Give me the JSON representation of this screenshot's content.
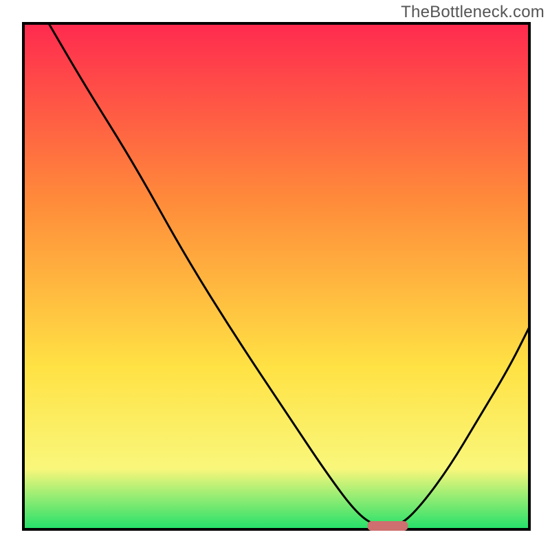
{
  "watermark": "TheBottleneck.com",
  "chart_data": {
    "type": "line",
    "title": "",
    "xlabel": "",
    "ylabel": "",
    "xlim": [
      0,
      100
    ],
    "ylim": [
      0,
      100
    ],
    "note": "No axis ticks or numeric labels are rendered in the image. The black curve descends from top-left, reaches a flat minimum around x≈68–74, then rises toward the right. A short salmon-colored marker band sits on the x-axis at the minimum.",
    "series": [
      {
        "name": "bottleneck_curve",
        "color": "#000000",
        "points": [
          {
            "x": 5,
            "y": 100
          },
          {
            "x": 12,
            "y": 88
          },
          {
            "x": 22,
            "y": 72
          },
          {
            "x": 32,
            "y": 54
          },
          {
            "x": 42,
            "y": 38
          },
          {
            "x": 52,
            "y": 23
          },
          {
            "x": 60,
            "y": 11
          },
          {
            "x": 66,
            "y": 3
          },
          {
            "x": 70,
            "y": 0.5
          },
          {
            "x": 74,
            "y": 0.5
          },
          {
            "x": 78,
            "y": 4
          },
          {
            "x": 84,
            "y": 12
          },
          {
            "x": 90,
            "y": 22
          },
          {
            "x": 96,
            "y": 32
          },
          {
            "x": 100,
            "y": 40
          }
        ]
      }
    ],
    "marker": {
      "name": "optimal_band",
      "color": "#cf6f6f",
      "x_start": 68,
      "x_end": 76,
      "y": 0
    },
    "background_gradient": {
      "top": "#ff2a4f",
      "mid1": "#ff8b3a",
      "mid2": "#ffe244",
      "mid3": "#f9f77b",
      "bottom": "#22e06a"
    }
  }
}
